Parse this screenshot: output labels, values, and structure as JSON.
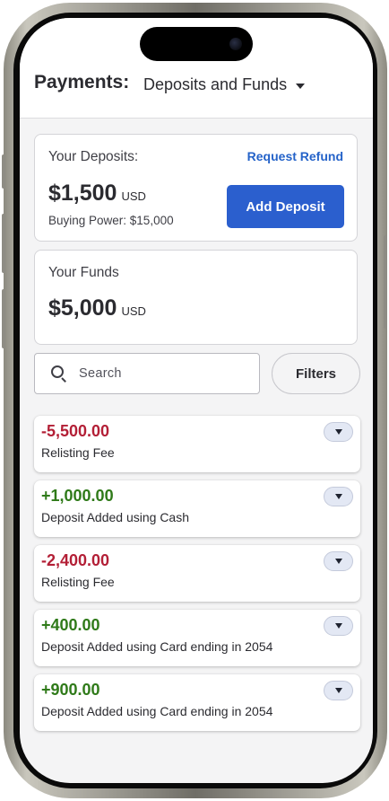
{
  "header": {
    "title": "Payments:",
    "section": "Deposits and Funds"
  },
  "deposits": {
    "label": "Your Deposits:",
    "refund_link": "Request Refund",
    "amount": "$1,500",
    "currency": "USD",
    "buying_power": "Buying Power: $15,000",
    "add_button": "Add Deposit"
  },
  "funds": {
    "label": "Your Funds",
    "amount": "$5,000",
    "currency": "USD"
  },
  "search": {
    "placeholder": "Search",
    "filters_label": "Filters"
  },
  "transactions": [
    {
      "amount": "-5,500.00",
      "description": "Relisting Fee",
      "kind": "negative"
    },
    {
      "amount": "+1,000.00",
      "description": "Deposit Added using Cash",
      "kind": "positive"
    },
    {
      "amount": "-2,400.00",
      "description": "Relisting Fee",
      "kind": "negative"
    },
    {
      "amount": "+400.00",
      "description": "Deposit Added using Card ending in 2054",
      "kind": "positive"
    },
    {
      "amount": "+900.00",
      "description": "Deposit Added using Card ending in 2054",
      "kind": "positive"
    }
  ],
  "colors": {
    "accent": "#2b5fce",
    "link": "#2563c9",
    "negative": "#b31f36",
    "positive": "#2f7a19"
  },
  "icons": {
    "section_dropdown": "caret-down-icon",
    "search": "search-icon",
    "expand": "chevron-down-icon"
  }
}
